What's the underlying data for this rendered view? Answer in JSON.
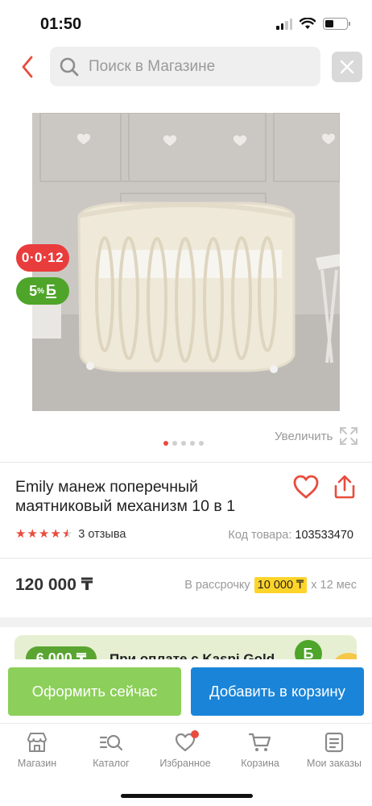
{
  "status_bar": {
    "time": "01:50"
  },
  "search": {
    "placeholder": "Поиск в Магазине"
  },
  "product": {
    "badges": {
      "installment": "0·0·12",
      "bonus_value": "5",
      "bonus_percent": "%",
      "bonus_symbol": "Б"
    },
    "gallery": {
      "image_count": 5,
      "active_index": 0,
      "zoom_label": "Увеличить"
    },
    "title": "Emily манеж поперечный маятниковый механизм 10 в 1",
    "rating": {
      "stars": 4.5,
      "reviews": "3 отзыва"
    },
    "sku": {
      "label": "Код товара:",
      "value": "103533470"
    },
    "price": "120 000 ₸",
    "installment": {
      "prefix": "В рассрочку",
      "amount": "10 000 ₸",
      "suffix": "x 12 мес"
    }
  },
  "promo": {
    "amount": "6 000 ₸",
    "text": "При оплате с Kaspi Gold",
    "icon_symbol": "Б"
  },
  "actions": {
    "buy_now": "Оформить сейчас",
    "add_to_cart": "Добавить в корзину"
  },
  "tab_bar": {
    "items": [
      {
        "label": "Магазин",
        "icon": "store-icon"
      },
      {
        "label": "Каталог",
        "icon": "catalog-search-icon"
      },
      {
        "label": "Избранное",
        "icon": "heart-icon",
        "has_notification": true
      },
      {
        "label": "Корзина",
        "icon": "cart-icon"
      },
      {
        "label": "Мои заказы",
        "icon": "orders-icon"
      }
    ]
  },
  "colors": {
    "accent_red": "#e84c3d",
    "buy_green": "#8ccf5a",
    "cart_blue": "#1a85d8",
    "bonus_green": "#4ea52a",
    "installment_yellow": "#ffd42a"
  }
}
